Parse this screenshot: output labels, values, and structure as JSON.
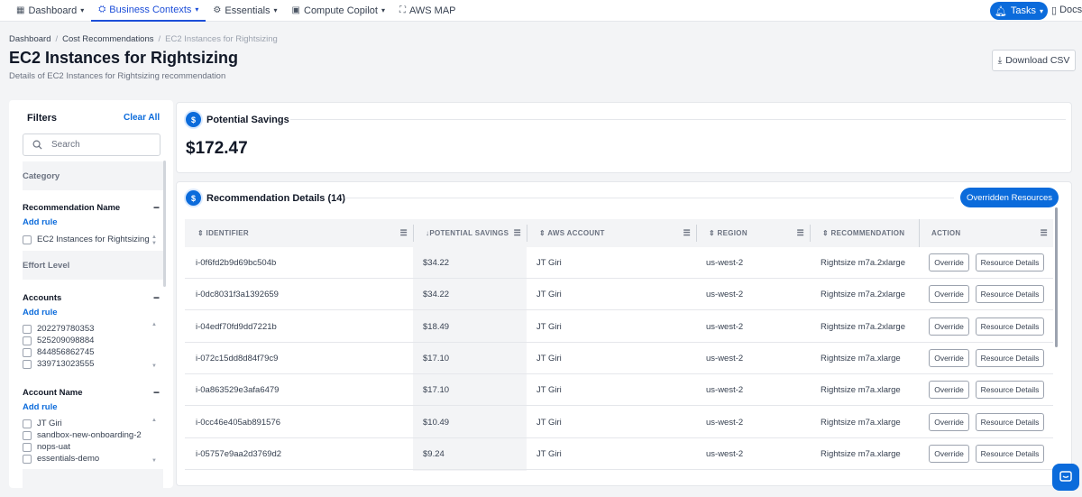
{
  "nav": {
    "items": [
      {
        "label": "Dashboard",
        "icon": "dashboard-grid-icon"
      },
      {
        "label": "Business Contexts",
        "icon": "business-contexts-icon",
        "active": true
      },
      {
        "label": "Essentials",
        "icon": "essentials-gear-icon"
      },
      {
        "label": "Compute Copilot",
        "icon": "compute-copilot-icon"
      },
      {
        "label": "AWS MAP",
        "icon": "aws-map-icon"
      }
    ],
    "tasks_label": "Tasks",
    "docs_label": "Docs"
  },
  "breadcrumb": [
    "Dashboard",
    "Cost Recommendations",
    "EC2 Instances for Rightsizing"
  ],
  "page": {
    "title": "EC2 Instances for Rightsizing",
    "subtitle": "Details of EC2 Instances for Rightsizing recommendation",
    "download_label": "Download CSV"
  },
  "filters": {
    "title": "Filters",
    "clear_all": "Clear All",
    "search_placeholder": "Search",
    "category_label": "Category",
    "recommendation_name": {
      "label": "Recommendation Name",
      "add_rule": "Add rule",
      "options": [
        "EC2 Instances for Rightsizing"
      ]
    },
    "effort_level_label": "Effort Level",
    "accounts": {
      "label": "Accounts",
      "add_rule": "Add rule",
      "options": [
        "202279780353",
        "525209098884",
        "844856862745",
        "339713023555"
      ]
    },
    "account_name": {
      "label": "Account Name",
      "add_rule": "Add rule",
      "options": [
        "JT Giri",
        "sandbox-new-onboarding-2",
        "nops-uat",
        "essentials-demo"
      ]
    }
  },
  "savings": {
    "title": "Potential Savings",
    "amount": "$172.47"
  },
  "details": {
    "title": "Recommendation Details (14)",
    "overridden_label": "Overridden Resources",
    "columns": [
      "IDENTIFIER",
      "POTENTIAL SAVINGS",
      "AWS ACCOUNT",
      "REGION",
      "RECOMMENDATION",
      "ACTION"
    ],
    "override_label": "Override",
    "resource_details_label": "Resource Details",
    "rows": [
      {
        "identifier": "i-0f6fd2b9d69bc504b",
        "savings": "$34.22",
        "account": "JT Giri",
        "region": "us-west-2",
        "recommendation": "Rightsize m7a.2xlarge"
      },
      {
        "identifier": "i-0dc8031f3a1392659",
        "savings": "$34.22",
        "account": "JT Giri",
        "region": "us-west-2",
        "recommendation": "Rightsize m7a.2xlarge"
      },
      {
        "identifier": "i-04edf70fd9dd7221b",
        "savings": "$18.49",
        "account": "JT Giri",
        "region": "us-west-2",
        "recommendation": "Rightsize m7a.2xlarge"
      },
      {
        "identifier": "i-072c15dd8d84f79c9",
        "savings": "$17.10",
        "account": "JT Giri",
        "region": "us-west-2",
        "recommendation": "Rightsize m7a.xlarge"
      },
      {
        "identifier": "i-0a863529e3afa6479",
        "savings": "$17.10",
        "account": "JT Giri",
        "region": "us-west-2",
        "recommendation": "Rightsize m7a.xlarge"
      },
      {
        "identifier": "i-0cc46e405ab891576",
        "savings": "$10.49",
        "account": "JT Giri",
        "region": "us-west-2",
        "recommendation": "Rightsize m7a.xlarge"
      },
      {
        "identifier": "i-05757e9aa2d3769d2",
        "savings": "$9.24",
        "account": "JT Giri",
        "region": "us-west-2",
        "recommendation": "Rightsize m7a.xlarge"
      }
    ]
  },
  "colors": {
    "accent": "#0b6bdb",
    "page_bg": "#f3f4f6"
  }
}
